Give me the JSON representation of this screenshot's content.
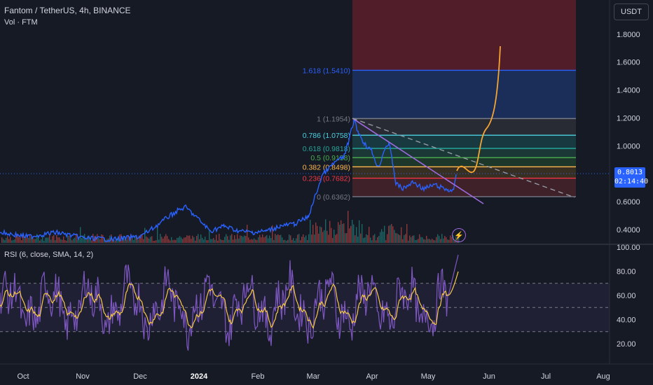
{
  "header": {
    "symbol_line": "Fantom / TetherUS, 4h, BINANCE",
    "volume_line": "Vol · FTM",
    "currency_button": "USDT"
  },
  "price_axis": {
    "ticks": [
      "1.8000",
      "1.6000",
      "1.4000",
      "1.2000",
      "1.0000",
      "0.8000",
      "0.6000",
      "0.4000"
    ],
    "tick_values": [
      1.8,
      1.6,
      1.4,
      1.2,
      1.0,
      0.8,
      0.6,
      0.4
    ]
  },
  "current_price": {
    "value": "0.8013",
    "countdown": "02:14:40",
    "price": 0.8013
  },
  "fib_levels": [
    {
      "label": "1.618 (1.5410)",
      "ratio": 1.618,
      "price": 1.541,
      "color": "#2962ff"
    },
    {
      "label": "1 (1.1954)",
      "ratio": 1,
      "price": 1.1954,
      "color": "#787b86"
    },
    {
      "label": "0.786 (1.0758)",
      "ratio": 0.786,
      "price": 1.0758,
      "color": "#4dd0e1"
    },
    {
      "label": "0.618 (0.9818)",
      "ratio": 0.618,
      "price": 0.9818,
      "color": "#26a69a"
    },
    {
      "label": "0.5 (0.9158)",
      "ratio": 0.5,
      "price": 0.9158,
      "color": "#4caf50"
    },
    {
      "label": "0.382 (0.8498)",
      "ratio": 0.382,
      "price": 0.8498,
      "color": "#ffb74d"
    },
    {
      "label": "0.236 (0.7682)",
      "ratio": 0.236,
      "price": 0.7682,
      "color": "#f23645"
    },
    {
      "label": "0 (0.6362)",
      "ratio": 0,
      "price": 0.6362,
      "color": "#787b86"
    }
  ],
  "rsi": {
    "title": "RSI (6, close, SMA, 14, 2)",
    "ticks": [
      "100.00",
      "80.00",
      "60.00",
      "40.00",
      "20.00"
    ],
    "tick_values": [
      100,
      80,
      60,
      40,
      20
    ],
    "upper_band": 70,
    "lower_band": 30,
    "middle": 50
  },
  "time_axis": {
    "labels": [
      "Oct",
      "Nov",
      "Dec",
      "2024",
      "Feb",
      "Mar",
      "Apr",
      "May",
      "Jun",
      "Jul",
      "Aug"
    ]
  },
  "colors": {
    "background": "#161a25",
    "price_line": "#2962ff",
    "projection": "#f7a530",
    "trendline": "#9c6ade",
    "rsi_line": "#7e57c2",
    "rsi_ma": "#f7c948"
  },
  "icons": {
    "alert": "lightning-bolt-icon"
  }
}
